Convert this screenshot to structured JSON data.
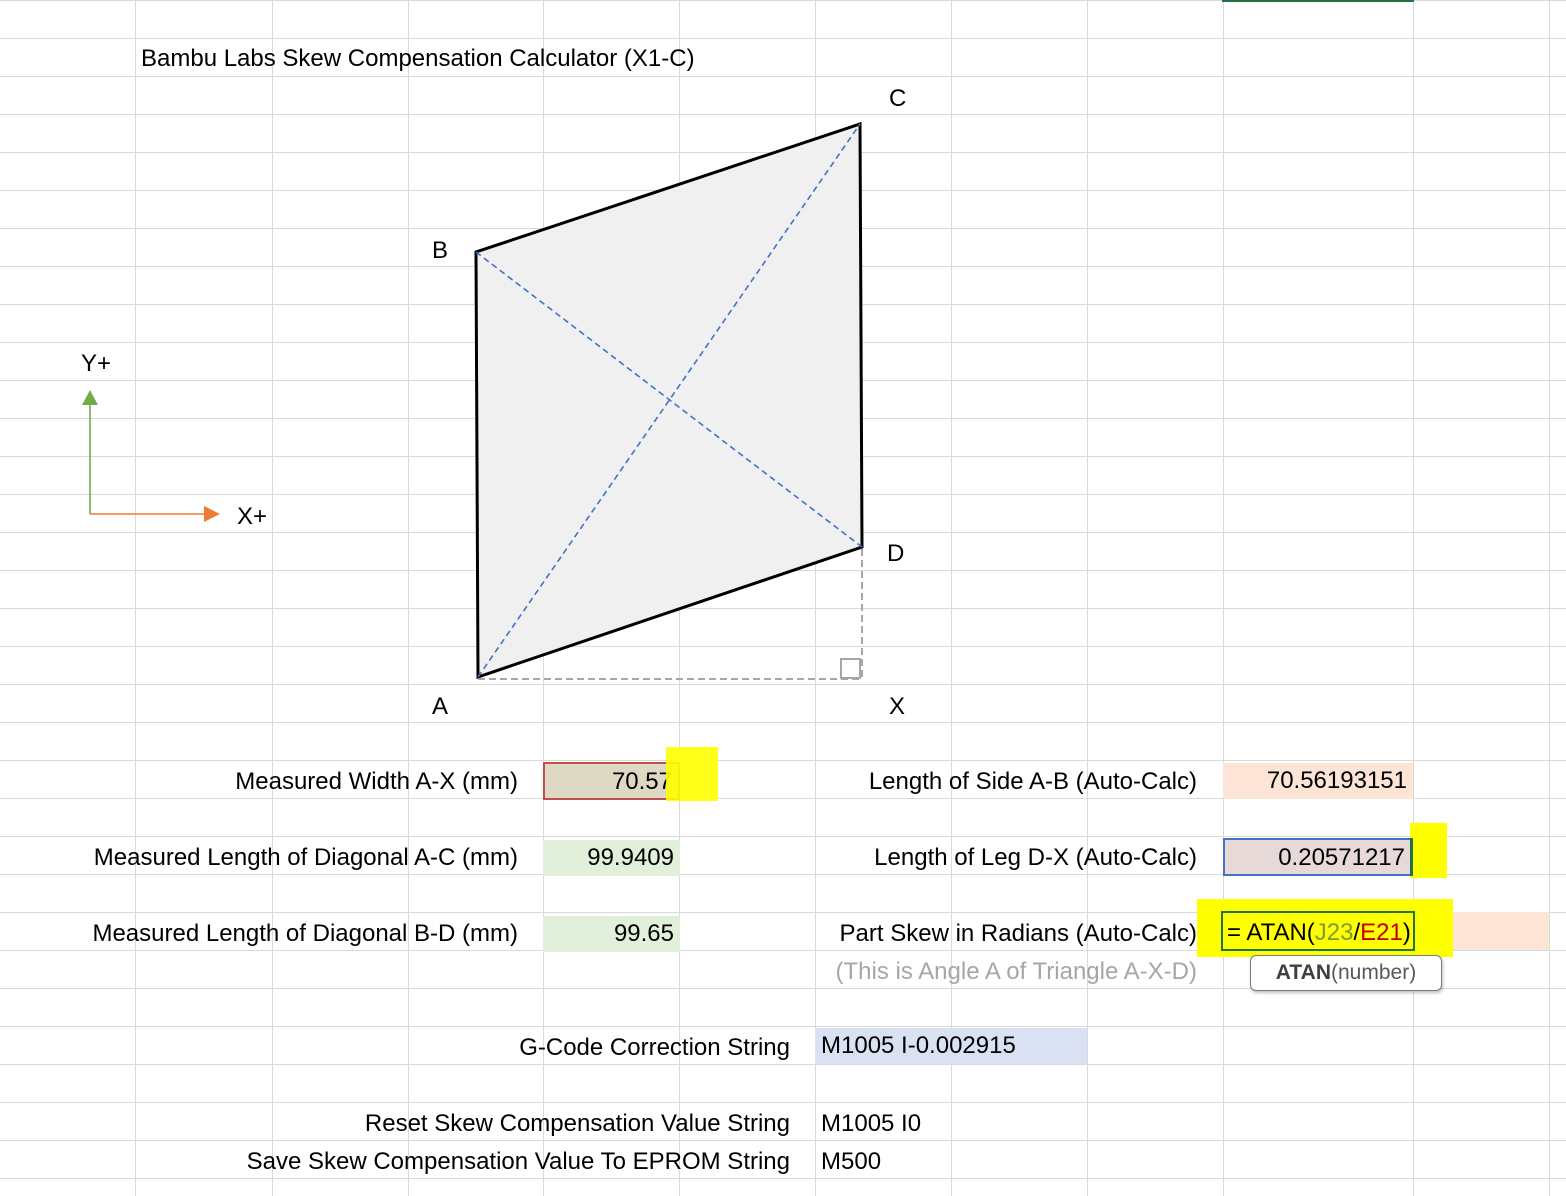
{
  "title": "Bambu Labs Skew Compensation Calculator (X1-C)",
  "diagram": {
    "vertex_labels": {
      "a": "A",
      "b": "B",
      "c": "C",
      "d": "D",
      "x": "X"
    },
    "axis_y_label": "Y+",
    "axis_x_label": "X+",
    "colors": {
      "shape_fill": "#f0f0f0",
      "diagonal": "#4472c4",
      "axis_y": "#70ad47",
      "axis_x": "#ed7d31"
    }
  },
  "inputs": {
    "width_label": "Measured Width A-X (mm)",
    "width_value": "70.57",
    "diag_ac_label": "Measured Length of Diagonal A-C (mm)",
    "diag_ac_value": "99.9409",
    "diag_bd_label": "Measured Length of Diagonal B-D (mm)",
    "diag_bd_value": "99.65"
  },
  "outputs": {
    "side_ab_label": "Length of Side A-B (Auto-Calc)",
    "side_ab_value": "70.56193151",
    "leg_dx_label": "Length of Leg D-X (Auto-Calc)",
    "leg_dx_value": "0.20571217",
    "skew_label": "Part Skew in Radians (Auto-Calc)",
    "skew_note": "(This is Angle A of Triangle A-X-D)",
    "formula": {
      "prefix": "= ATAN(",
      "ref1": "J23",
      "sep": "/",
      "ref2": "E21",
      "suffix": ")"
    },
    "tooltip_fn": "ATAN",
    "tooltip_arg": "(number)"
  },
  "gcode": {
    "correction_label": "G-Code Correction String",
    "correction_value": "M1005 I-0.002915",
    "reset_label": "Reset Skew Compensation Value String",
    "reset_value": "M1005 I0",
    "save_label": "Save Skew Compensation Value To EPROM String",
    "save_value": "M500"
  }
}
